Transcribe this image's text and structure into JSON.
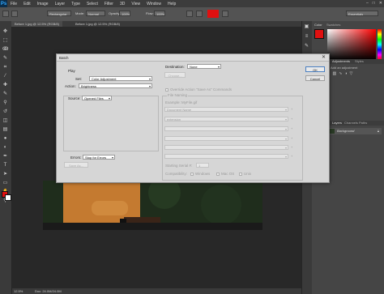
{
  "app": {
    "logo": "Ps"
  },
  "menubar": {
    "items": [
      "File",
      "Edit",
      "Image",
      "Layer",
      "Type",
      "Select",
      "Filter",
      "3D",
      "View",
      "Window",
      "Help"
    ],
    "window_controls": [
      "–",
      "□",
      "✕"
    ]
  },
  "options_bar": {
    "tool_preset": "Rectangular",
    "mode_label": "Mode:",
    "mode_value": "Normal",
    "opacity_label": "Opacity:",
    "opacity_value": "100%",
    "flow_label": "Flow:",
    "flow_value": "100%",
    "workspace": "Essentials",
    "swatch_color": "#e01010"
  },
  "doc_tabs": [
    "Before 1.jpg @ 12.5% (RGB/8)",
    "Before 1.jpg @ 12.5% (RGB/8)"
  ],
  "panels": {
    "color_tabs": [
      "Color",
      "Swatches"
    ],
    "adjust_tabs": [
      "Adjustments",
      "Styles"
    ],
    "add_adjustment": "Add an adjustment",
    "layers_tabs": [
      "Layers",
      "Channels",
      "Paths"
    ],
    "layer_name": "Background"
  },
  "status": {
    "zoom": "12.5%",
    "doc_info": "Doc: 24.0M/24.0M"
  },
  "dialog": {
    "title": "Batch",
    "close": "✕",
    "play_label": "Play",
    "set_label": "Set:",
    "set_value": "Color Adjustment",
    "action_label": "Action:",
    "action_value": "Brightness",
    "source_label": "Source:",
    "source_value": "Opened Files",
    "errors_label": "Errors:",
    "errors_value": "Stop for Errors",
    "save_as_button": "Save As...",
    "destination_label": "Destination:",
    "destination_value": "None",
    "choose_button": "Choose...",
    "override_label": "Override Action \"Save As\" Commands",
    "file_naming_label": "File Naming",
    "example_label": "Example: MyFile.gif",
    "naming_rows": [
      "Document Name",
      "extension",
      "",
      "",
      "",
      ""
    ],
    "plus_glyph": "+",
    "serial_label": "Starting Serial #:",
    "serial_value": "1",
    "compat_label": "Compatibility:",
    "compat_windows": "Windows",
    "compat_mac": "Mac OS",
    "compat_unix": "Unix",
    "ok_button": "OK",
    "cancel_button": "Cancel"
  }
}
